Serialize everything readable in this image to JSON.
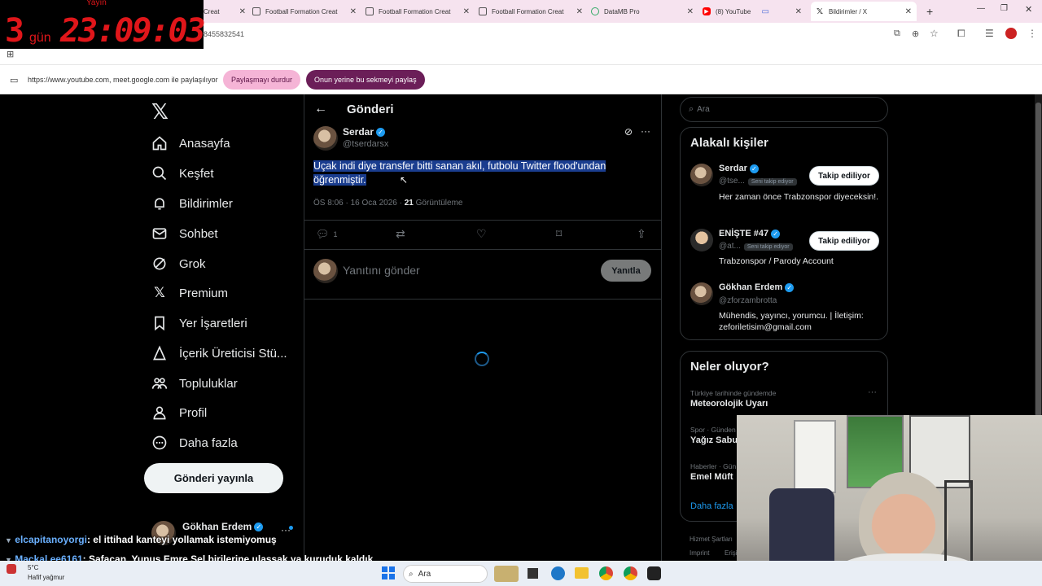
{
  "browser": {
    "tabs": [
      {
        "label": "Creat"
      },
      {
        "label": "Football Formation Creat"
      },
      {
        "label": "Football Formation Creat"
      },
      {
        "label": "Football Formation Creat"
      },
      {
        "label": "DataMB Pro"
      },
      {
        "label": "(8) YouTube"
      },
      {
        "label": "Bildirimler / X"
      }
    ],
    "address_fragment": "8455832541",
    "share_text": "https://www.youtube.com, meet.google.com ile paylaşılıyor",
    "stop_sharing_label": "Paylaşmayı durdur",
    "share_this_tab_label": "Onun yerine bu sekmeyi paylaş"
  },
  "timer": {
    "label": "Yayın",
    "days": "3",
    "days_unit": "gün",
    "time": "23:09:03"
  },
  "nav": {
    "items": [
      {
        "label": "Anasayfa"
      },
      {
        "label": "Keşfet"
      },
      {
        "label": "Bildirimler"
      },
      {
        "label": "Sohbet"
      },
      {
        "label": "Grok"
      },
      {
        "label": "Premium"
      },
      {
        "label": "Yer İşaretleri"
      },
      {
        "label": "İçerik Üreticisi Stü..."
      },
      {
        "label": "Topluluklar"
      },
      {
        "label": "Profil"
      },
      {
        "label": "Daha fazla"
      }
    ],
    "post_button": "Gönderi yayınla",
    "account_name": "Gökhan Erdem"
  },
  "post": {
    "header_title": "Gönderi",
    "author_name": "Serdar",
    "author_handle": "@tserdarsx",
    "text_line1": "Uçak indi diye transfer bitti sanan akıl, futbolu Twitter flood'undan",
    "text_line2": "öğrenmiştir.",
    "time": "ÖS 8:06",
    "date": "16 Oca 2026",
    "views_count": "21",
    "views_label": "Görüntüleme",
    "reply_count": "1",
    "reply_placeholder": "Yanıtını gönder",
    "reply_button": "Yanıtla"
  },
  "search": {
    "placeholder": "Ara"
  },
  "related": {
    "title": "Alakalı kişiler",
    "people": [
      {
        "name": "Serdar",
        "handle": "@tse...",
        "tag": "Seni takip ediyor",
        "bio": "Her zaman önce Trabzonspor diyeceksin!.",
        "button": "Takip ediliyor"
      },
      {
        "name": "ENİŞTE #47",
        "handle": "@at...",
        "tag": "Seni takip ediyor",
        "bio": "Trabzonspor / Parody Account",
        "button": "Takip ediliyor"
      },
      {
        "name": "Gökhan Erdem",
        "handle": "@zforzambrotta",
        "bio": "Mühendis, yayıncı, yorumcu. | İletişim: zeforiletisim@gmail.com"
      }
    ]
  },
  "trends": {
    "title": "Neler oluyor?",
    "items": [
      {
        "context": "Türkiye tarihinde gündemde",
        "name": "Meteorolojik Uyarı"
      },
      {
        "context": "Spor · Günden",
        "name": "Yağız Sabu"
      },
      {
        "context": "Haberler · Gün",
        "name": "Emel Müft"
      }
    ],
    "show_more": "Daha fazla"
  },
  "footer": {
    "terms": "Hizmet Şartları",
    "imprint": "Imprint",
    "extra": "Erişi"
  },
  "chat": [
    {
      "user": "elcapitanoyorgi",
      "text": ": el ittihad kanteyi yollamak istemiyomuş"
    },
    {
      "user": "Mackal ee6161",
      "text": ": Safacan, Yunus Emre Sel birilerine ulaşsak ya kuruduk kaldık"
    }
  ],
  "taskbar": {
    "weather_temp": "5°C",
    "weather_desc": "Hafif yağmur",
    "search_label": "Ara"
  },
  "colors": {
    "accent": "#1d9bf0",
    "selection": "#1a3d8f",
    "timer_red": "#e0161a",
    "pill_pink": "#f5b4d6",
    "pill_purple": "#6b1e58"
  }
}
